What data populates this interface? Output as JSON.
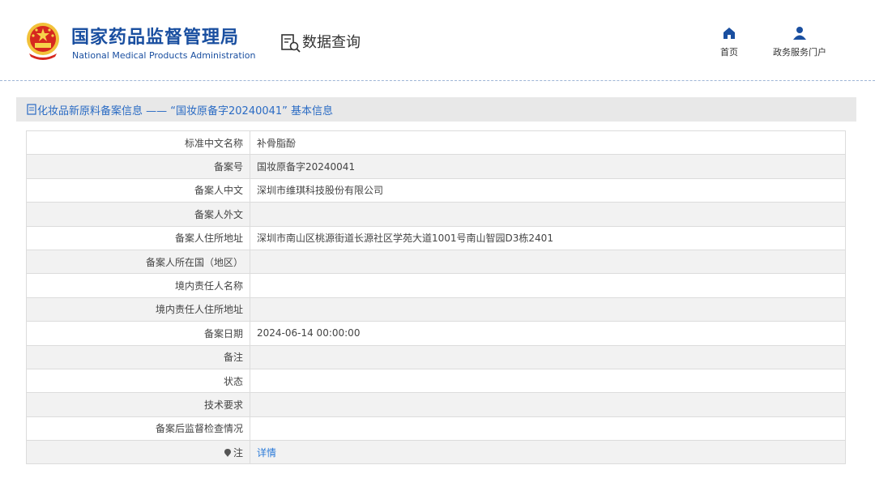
{
  "header": {
    "org_name_cn": "国家药品监督管理局",
    "org_name_en": "National Medical Products Administration",
    "section_label": "数据查询",
    "nav": [
      {
        "label": "首页",
        "icon": "home-icon"
      },
      {
        "label": "政务服务门户",
        "icon": "user-icon"
      }
    ]
  },
  "section": {
    "title": "化妆品新原料备案信息 —— “国妆原备字20240041” 基本信息",
    "icon": "document-icon"
  },
  "rows": [
    {
      "label": "标准中文名称",
      "value": "补骨脂酚"
    },
    {
      "label": "备案号",
      "value": "国妆原备字20240041"
    },
    {
      "label": "备案人中文",
      "value": "深圳市维琪科技股份有限公司"
    },
    {
      "label": "备案人外文",
      "value": ""
    },
    {
      "label": "备案人住所地址",
      "value": "深圳市南山区桃源街道长源社区学苑大道1001号南山智园D3栋2401"
    },
    {
      "label": "备案人所在国（地区）",
      "value": ""
    },
    {
      "label": "境内责任人名称",
      "value": ""
    },
    {
      "label": "境内责任人住所地址",
      "value": ""
    },
    {
      "label": "备案日期",
      "value": "2024-06-14 00:00:00"
    },
    {
      "label": "备注",
      "value": ""
    },
    {
      "label": "状态",
      "value": ""
    },
    {
      "label": "技术要求",
      "value": ""
    },
    {
      "label": "备案后监督检查情况",
      "value": ""
    },
    {
      "label": "注",
      "value": "详情",
      "icon": "pin-icon"
    }
  ],
  "colors": {
    "brand": "#1a4fa0",
    "link": "#2a7ad8",
    "section_bg": "#e8e8e8",
    "row_alt": "#f2f2f2",
    "border": "#dcdcdc"
  }
}
